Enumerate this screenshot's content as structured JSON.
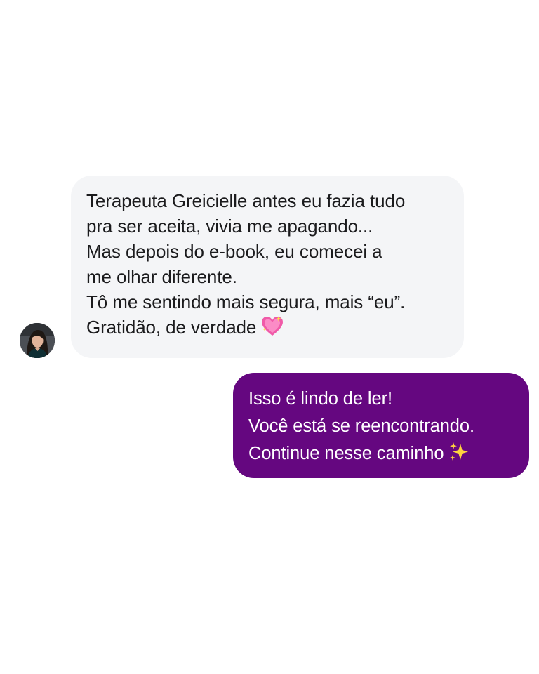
{
  "conversation": {
    "incoming": {
      "lines": [
        "Terapeuta Greicielle antes eu fazia tudo",
        "pra ser aceita, vivia me apagando...",
        "Mas depois do e-book, eu comecei a",
        "me olhar diferente.",
        "Tô me sentindo mais segura, mais “eu”.",
        "Gratidão, de verdade"
      ],
      "emoji": "sparkling-heart-icon"
    },
    "outgoing": {
      "lines": [
        "Isso é lindo de ler!",
        "Você está se reencontrando.",
        "Continue nesse caminho"
      ],
      "emoji": "sparkles-icon"
    }
  },
  "colors": {
    "incoming_bubble": "#f4f5f7",
    "outgoing_bubble": "#650780",
    "incoming_text": "#1b1b1d",
    "outgoing_text": "#ffffff"
  }
}
